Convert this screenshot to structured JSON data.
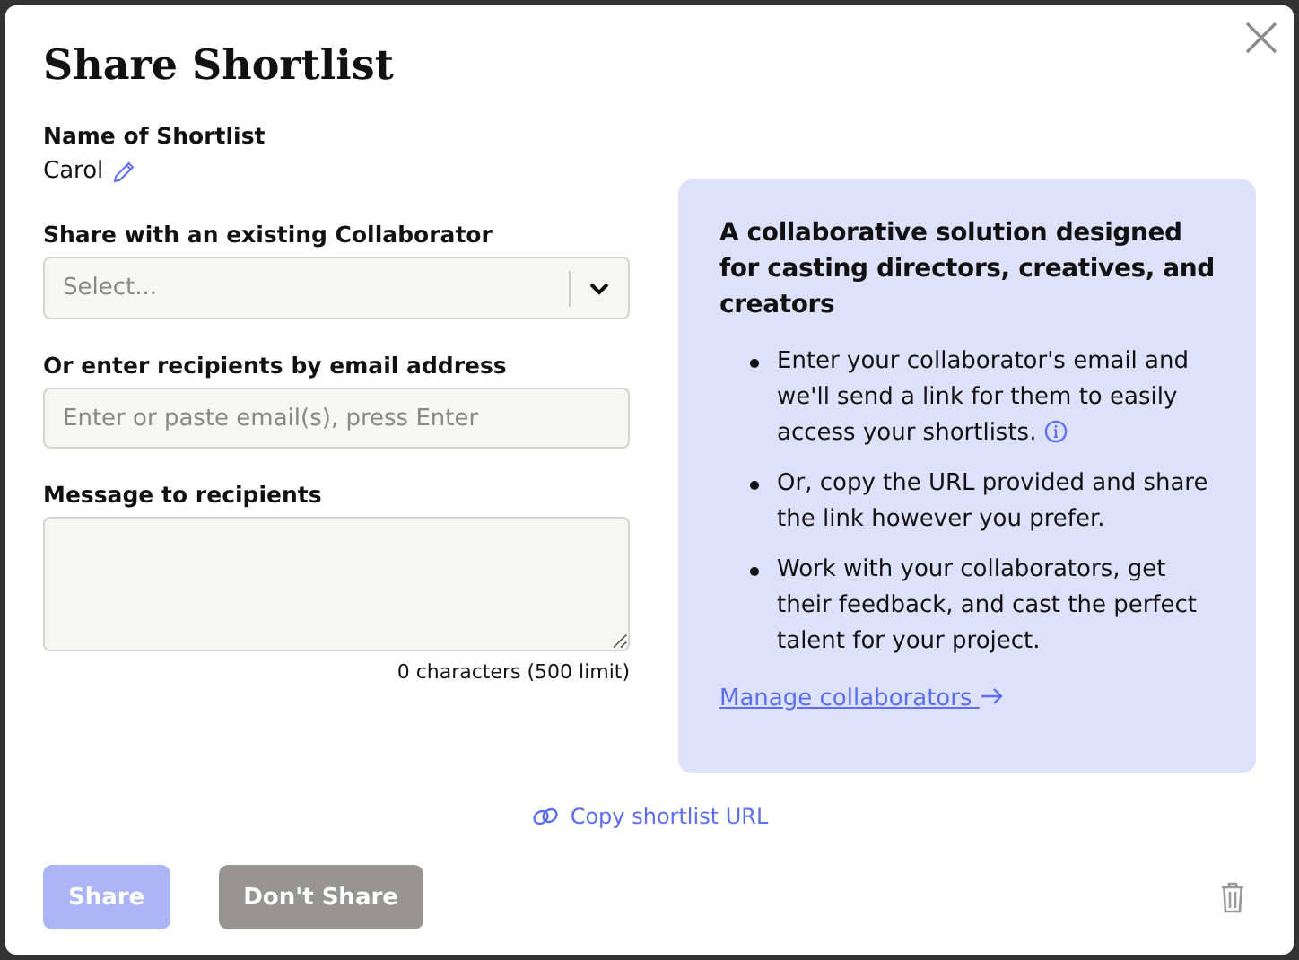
{
  "dialog": {
    "title": "Share Shortlist"
  },
  "name_field": {
    "label": "Name of Shortlist",
    "value": "Carol"
  },
  "collaborator_select": {
    "label": "Share with an existing Collaborator",
    "placeholder": "Select..."
  },
  "email_field": {
    "label": "Or enter recipients by email address",
    "placeholder": "Enter or paste email(s), press Enter"
  },
  "message_field": {
    "label": "Message to recipients",
    "counter": "0 characters (500 limit)"
  },
  "info_panel": {
    "heading": "A collaborative solution designed for casting directors, creatives, and creators",
    "bullets": [
      {
        "text": "Enter your collaborator's email and we'll send a link for them to easily access your shortlists.",
        "info_icon": true
      },
      {
        "text": "Or, copy the URL provided and share the link however you prefer.",
        "info_icon": false
      },
      {
        "text": "Work with your collaborators, get their feedback, and cast the perfect talent for your project.",
        "info_icon": false
      }
    ],
    "link": "Manage collaborators"
  },
  "copy_link": "Copy shortlist URL",
  "buttons": [
    {
      "label": "Share",
      "kind": "primary",
      "disabled": true
    },
    {
      "label": "Don't Share",
      "kind": "secondary",
      "disabled": false
    }
  ]
}
